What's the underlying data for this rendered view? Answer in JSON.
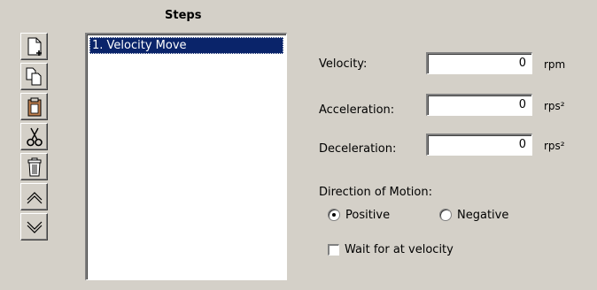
{
  "steps": {
    "title": "Steps",
    "items": [
      "1. Velocity Move"
    ],
    "selected_index": 0
  },
  "toolbar": {
    "buttons": [
      {
        "icon": "new-page-icon"
      },
      {
        "icon": "copy-icon"
      },
      {
        "icon": "paste-icon"
      },
      {
        "icon": "cut-icon"
      },
      {
        "icon": "delete-icon"
      },
      {
        "icon": "move-up-icon"
      },
      {
        "icon": "move-down-icon"
      }
    ]
  },
  "fields": {
    "velocity": {
      "label": "Velocity:",
      "value": "0",
      "unit": "rpm"
    },
    "acceleration": {
      "label": "Acceleration:",
      "value": "0",
      "unit": "rps²"
    },
    "deceleration": {
      "label": "Deceleration:",
      "value": "0",
      "unit": "rps²"
    }
  },
  "direction": {
    "label": "Direction of Motion:",
    "options": [
      "Positive",
      "Negative"
    ],
    "selected": "Positive"
  },
  "wait": {
    "label": "Wait for at velocity",
    "checked": false
  },
  "colors": {
    "background": "#d4d0c8",
    "selection": "#0a246a"
  }
}
